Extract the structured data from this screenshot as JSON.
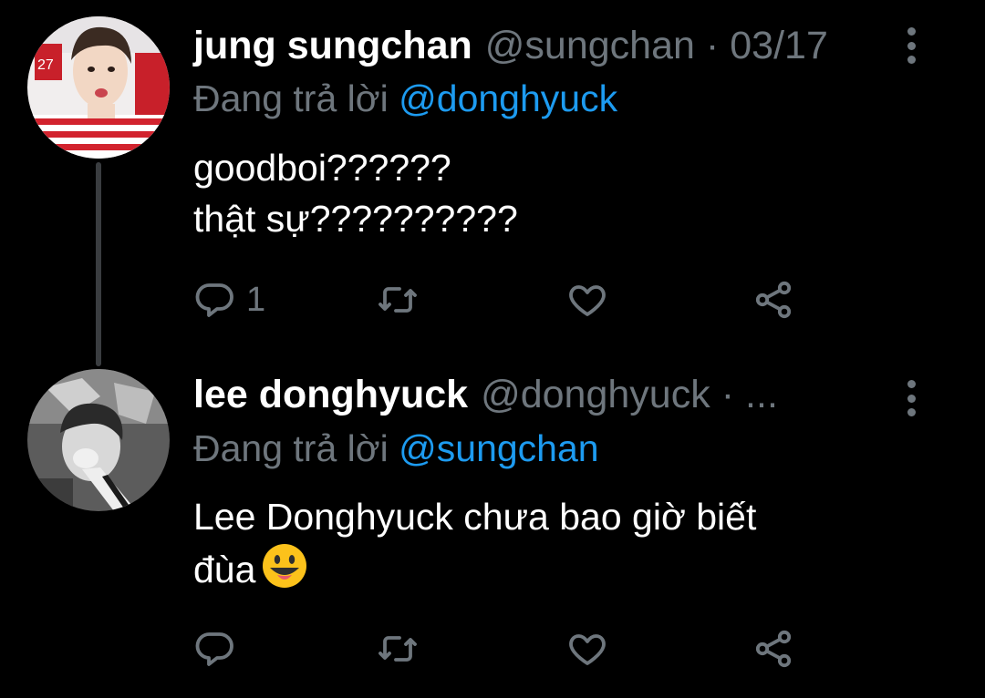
{
  "tweets": [
    {
      "name": "jung sungchan",
      "handle": "@sungchan",
      "dot": "·",
      "date": "03/17",
      "replying_prefix": "Đang trả lời",
      "replying_to": "@donghyuck",
      "body_lines": [
        "goodboi??????",
        "thật sự??????????"
      ],
      "reply_count": "1"
    },
    {
      "name": "lee donghyuck",
      "handle": "@donghyuck",
      "dot": "·",
      "date": "...",
      "replying_prefix": "Đang trả lời",
      "replying_to": "@sungchan",
      "body_lines": [
        "Lee Donghyuck chưa bao giờ biết",
        "đùa"
      ],
      "emoji": "grinning-face-with-tongue",
      "reply_count": ""
    }
  ],
  "icons": {
    "reply": "reply-icon",
    "retweet": "retweet-icon",
    "like": "like-icon",
    "share": "share-icon",
    "more": "more-vertical-icon"
  },
  "colors": {
    "background": "#000000",
    "text": "#ffffff",
    "muted": "#6e767d",
    "link": "#1d9bf0",
    "thread_line": "#3a3d40"
  }
}
